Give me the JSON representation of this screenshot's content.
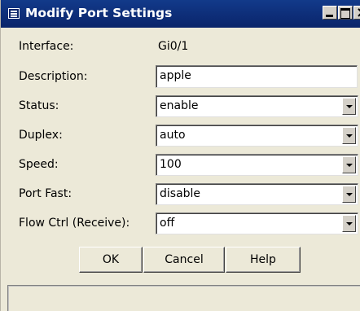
{
  "window": {
    "title": "Modify Port Settings"
  },
  "fields": {
    "interface": {
      "label": "Interface:",
      "value": "Gi0/1"
    },
    "description": {
      "label": "Description:",
      "value": "apple"
    },
    "status": {
      "label": "Status:",
      "value": "enable"
    },
    "duplex": {
      "label": "Duplex:",
      "value": "auto"
    },
    "speed": {
      "label": "Speed:",
      "value": "100"
    },
    "port_fast": {
      "label": "Port Fast:",
      "value": "disable"
    },
    "flow_ctrl": {
      "label": "Flow Ctrl (Receive):",
      "value": "off"
    }
  },
  "buttons": {
    "ok": "OK",
    "cancel": "Cancel",
    "help": "Help"
  },
  "status_bar": ""
}
